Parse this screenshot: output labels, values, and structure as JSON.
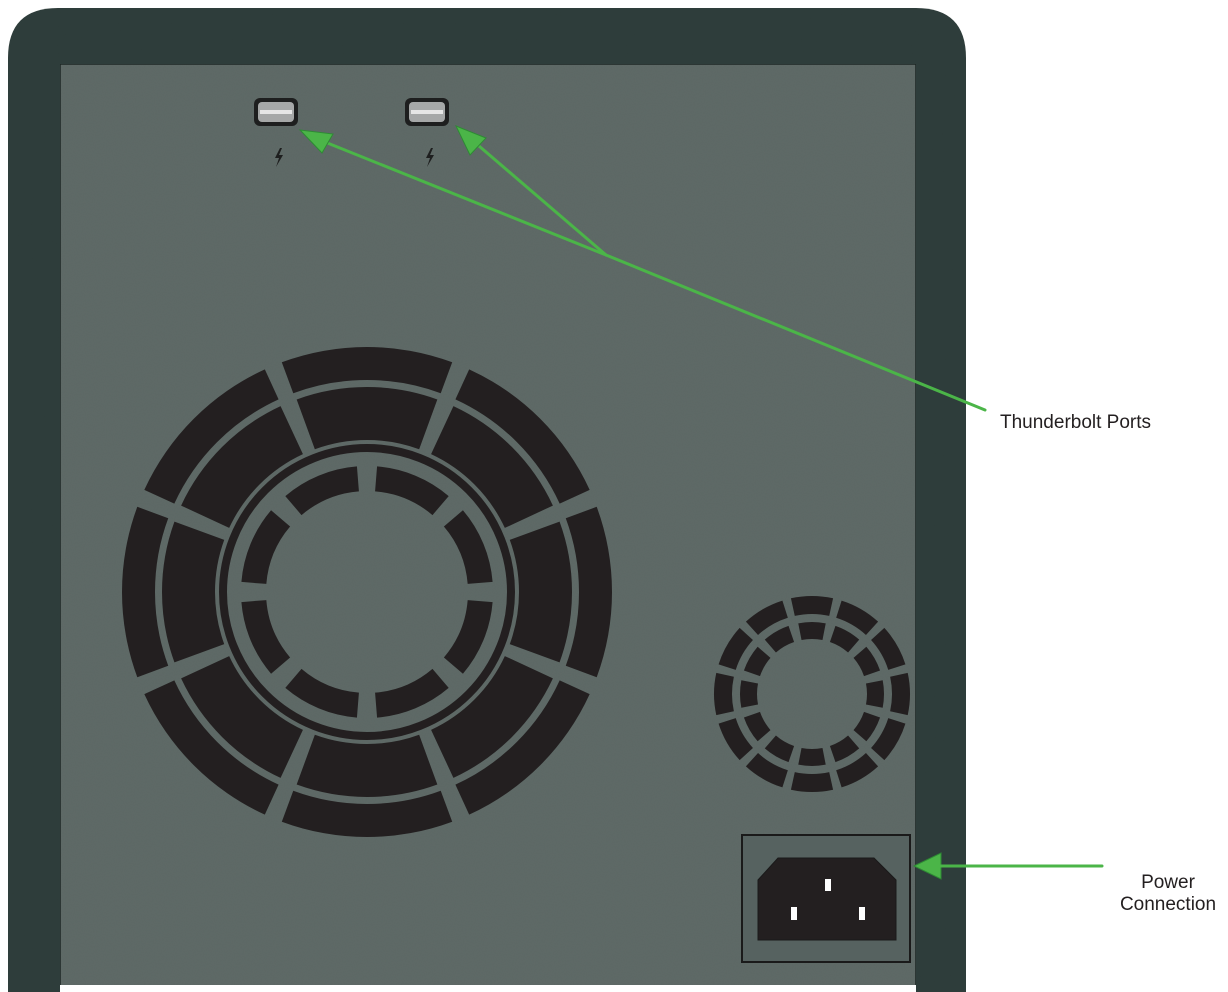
{
  "callouts": {
    "thunderbolt": "Thunderbolt Ports",
    "power_line1": "Power",
    "power_line2": "Connection"
  },
  "icons": {
    "port_symbol": "thunderbolt-icon",
    "power_inlet": "iec-c14-power-inlet-icon",
    "fan_grille": "fan-grille-icon"
  },
  "colors": {
    "enclosure_frame": "#2f3e3b",
    "back_panel": "#5f6a67",
    "vent_holes": "#231f20",
    "callout_arrow": "#4bb548",
    "label_text": "#231f20"
  }
}
